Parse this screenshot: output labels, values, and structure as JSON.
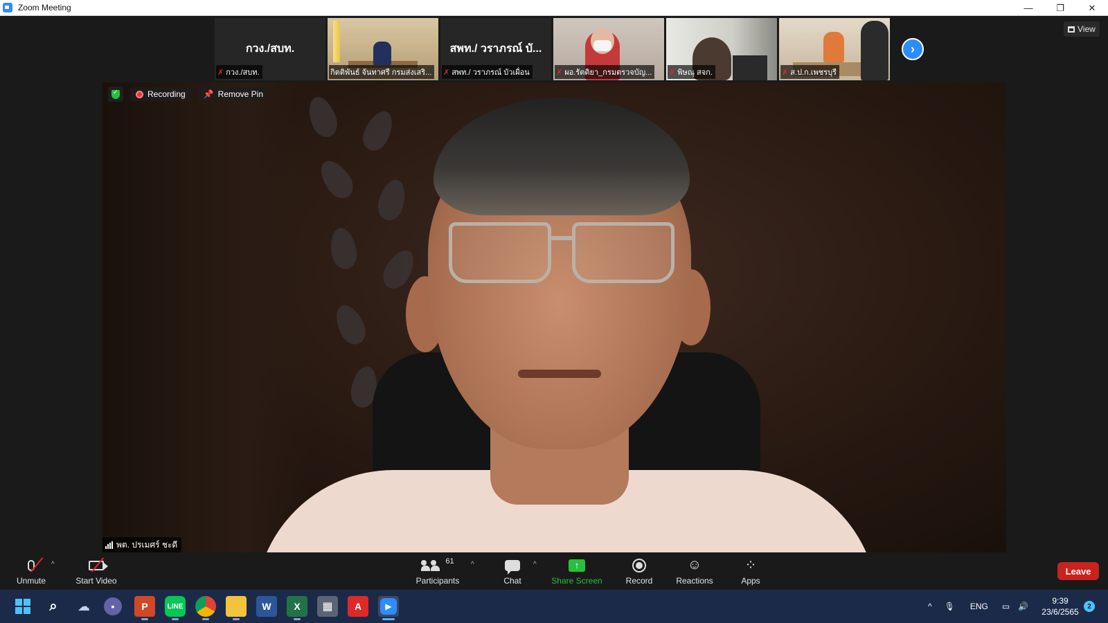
{
  "window": {
    "title": "Zoom Meeting",
    "controls": {
      "minimize": "—",
      "restore": "❐",
      "close": "✕"
    }
  },
  "thumbnails": [
    {
      "big_name": "กวง./สบท.",
      "label": "กวง./สบท.",
      "has_video": false
    },
    {
      "big_name": "",
      "label": "กิตติพันธ์ จันทาศรี กรมส่งเสริ...",
      "has_video": true
    },
    {
      "big_name": "สพท./ วราภรณ์ บั...",
      "label": "สพท./ วราภรณ์ บัวเผื่อน",
      "has_video": false
    },
    {
      "big_name": "",
      "label": "ผอ.รัตติยา_กรมตรวจบัญ...",
      "has_video": true
    },
    {
      "big_name": "",
      "label": "พิษณุ สจก.",
      "has_video": true
    },
    {
      "big_name": "",
      "label": "ส.ป.ก.เพชรบุรี",
      "has_video": true
    }
  ],
  "view_button": {
    "label": "View",
    "icon": "grid-icon"
  },
  "next_page_icon": "›",
  "main_video": {
    "recording_label": "Recording",
    "remove_pin_label": "Remove Pin",
    "speaker_name": "พต. ปรเมศร์ ชะดี"
  },
  "toolbar": {
    "unmute_label": "Unmute",
    "start_video_label": "Start Video",
    "participants_label": "Participants",
    "participants_count": "61",
    "chat_label": "Chat",
    "share_screen_label": "Share Screen",
    "record_label": "Record",
    "reactions_label": "Reactions",
    "apps_label": "Apps",
    "leave_label": "Leave",
    "share_color": "#26c13c",
    "leave_color": "#c8231e"
  },
  "taskbar": {
    "apps": [
      "windows-start",
      "search",
      "weather",
      "teams-chat",
      "powerpoint",
      "line",
      "chrome",
      "file-explorer",
      "word",
      "excel",
      "calculator",
      "acrobat",
      "zoom"
    ],
    "tray": {
      "language": "ENG",
      "time": "9:39",
      "date": "23/6/2565",
      "notification_count": "2"
    }
  }
}
